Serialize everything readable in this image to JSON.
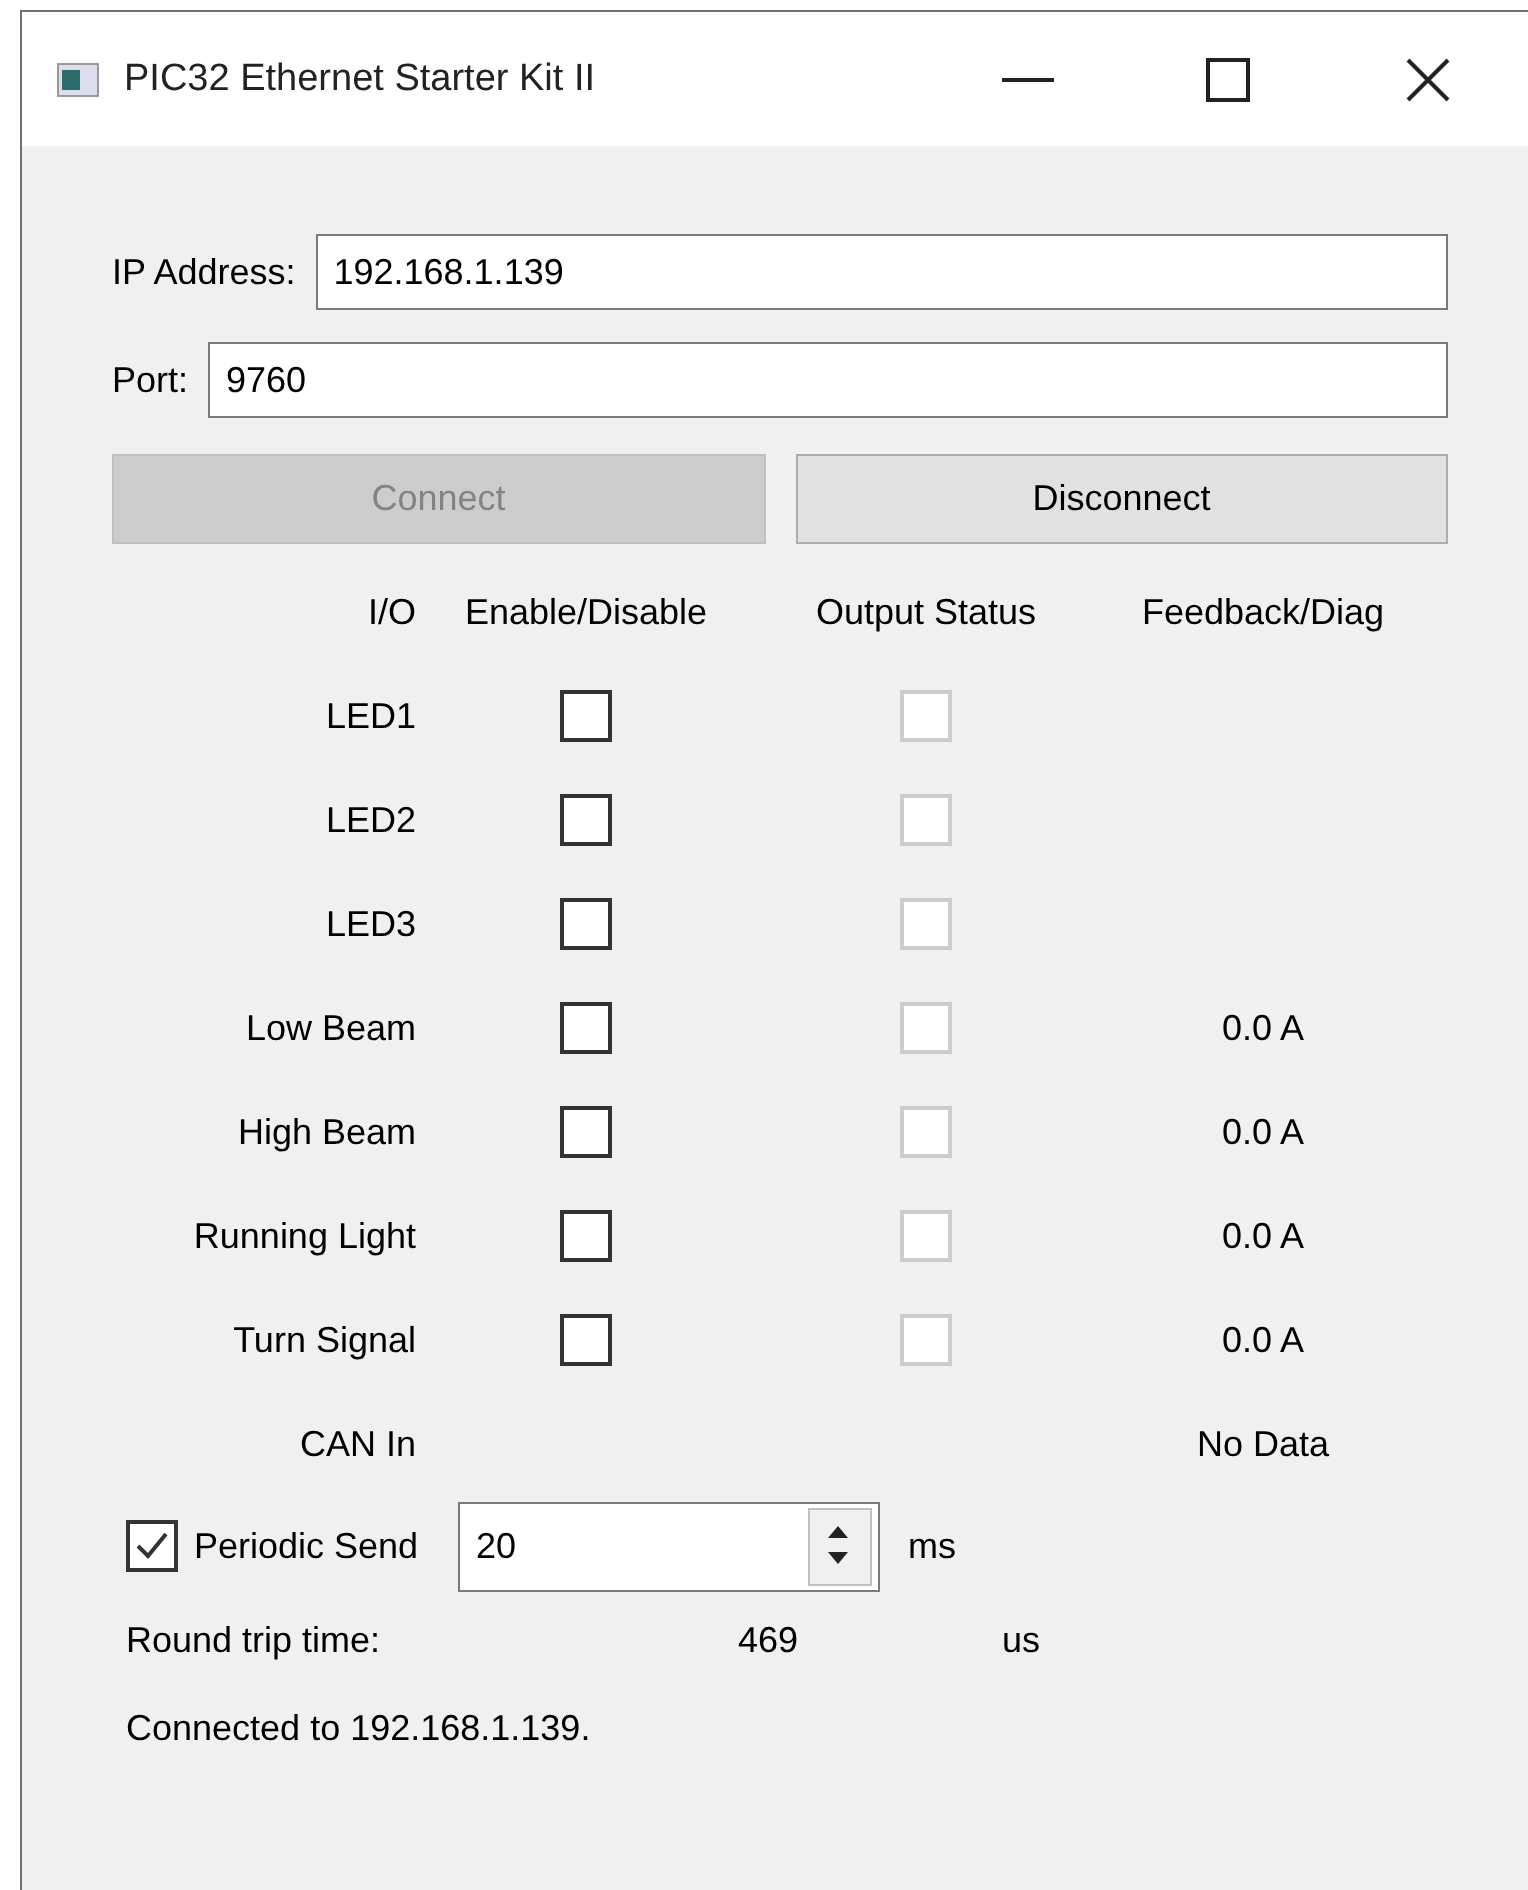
{
  "window": {
    "title": "PIC32 Ethernet Starter Kit II"
  },
  "ip_address": {
    "label": "IP Address:",
    "value": "192.168.1.139"
  },
  "port": {
    "label": "Port:",
    "value": "9760"
  },
  "buttons": [
    {
      "label": "Connect",
      "disabled": true
    },
    {
      "label": "Disconnect",
      "disabled": false
    }
  ],
  "io_table": {
    "columns": [
      "I/O",
      "Enable/Disable",
      "Output Status",
      "Feedback/Diag"
    ],
    "rows": [
      {
        "name": "LED1",
        "enable": {
          "checked": false
        },
        "output": {
          "checked": false,
          "disabled": true
        }
      },
      {
        "name": "LED2",
        "enable": {
          "checked": false
        },
        "output": {
          "checked": false,
          "disabled": true
        }
      },
      {
        "name": "LED3",
        "enable": {
          "checked": false
        },
        "output": {
          "checked": false,
          "disabled": true
        }
      },
      {
        "name": "Low Beam",
        "enable": {
          "checked": false
        },
        "output": {
          "checked": false,
          "disabled": true
        },
        "feedback": "0.0 A"
      },
      {
        "name": "High Beam",
        "enable": {
          "checked": false
        },
        "output": {
          "checked": false,
          "disabled": true
        },
        "feedback": "0.0 A"
      },
      {
        "name": "Running Light",
        "enable": {
          "checked": false
        },
        "output": {
          "checked": false,
          "disabled": true
        },
        "feedback": "0.0 A"
      },
      {
        "name": "Turn Signal",
        "enable": {
          "checked": false
        },
        "output": {
          "checked": false,
          "disabled": true
        },
        "feedback": "0.0 A"
      },
      {
        "name": "CAN In",
        "feedback": "No Data"
      }
    ]
  },
  "periodic_send": {
    "label": "Periodic Send",
    "checked": true,
    "value": "20",
    "unit": "ms"
  },
  "round_trip": {
    "label": "Round trip time:",
    "value": "469",
    "unit": "us"
  },
  "status": "Connected to 192.168.1.139."
}
